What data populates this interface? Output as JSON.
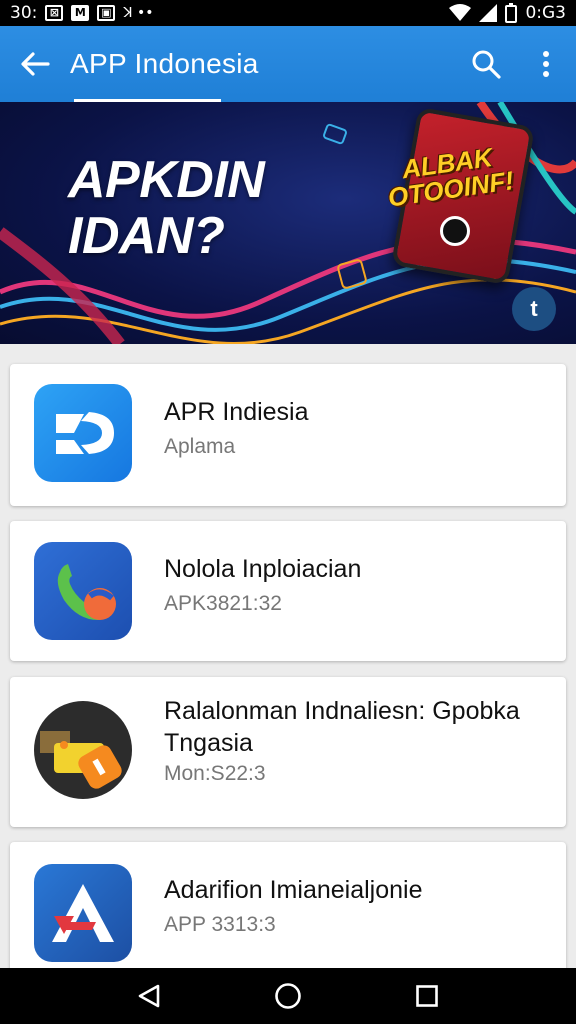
{
  "status_bar": {
    "time_left": "30:",
    "time_right": "0:G3",
    "left_icons": [
      "notification-box-icon",
      "gmail-icon",
      "bag-icon",
      "signal-dots-icon"
    ],
    "right_icons": [
      "wifi-icon",
      "cell-signal-icon",
      "battery-icon"
    ]
  },
  "app_bar": {
    "title": "APP Indonesia",
    "color": "#2287de"
  },
  "banner": {
    "headline_line1": "APKDIN",
    "headline_line2": "IDAN?",
    "badge_line1": "ALBAK",
    "badge_line2": "OTOOINF!",
    "fab_label": "t"
  },
  "apps": [
    {
      "title": "APR Indiesia",
      "subtitle": "Aplama",
      "icon": "apr-logo-icon"
    },
    {
      "title": "Nololа Inploiacian",
      "subtitle": "APK3821:32",
      "icon": "phone-call-icon"
    },
    {
      "title": "Ralalonman Indnaliesn: Gpobka Tngasia",
      "subtitle": "Mon:S22:3",
      "icon": "toolkit-icon"
    },
    {
      "title": "Adarifion Imianeialjonie",
      "subtitle": "APP 3313:3",
      "icon": "adarifion-logo-icon"
    }
  ],
  "nav_bar": {
    "buttons": [
      "back-triangle-icon",
      "home-circle-icon",
      "recents-square-icon"
    ]
  }
}
